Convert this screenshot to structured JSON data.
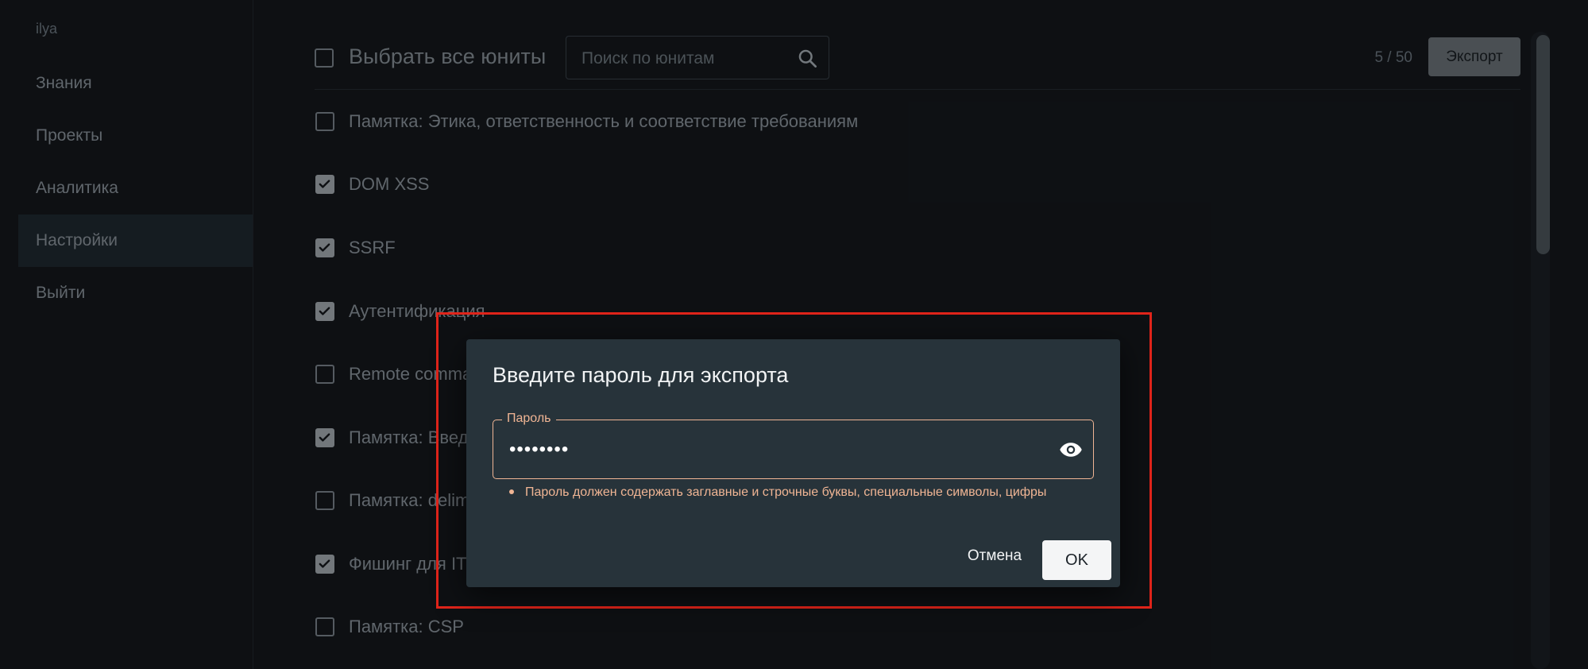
{
  "sidebar": {
    "username": "ilya",
    "items": [
      {
        "label": "Знания"
      },
      {
        "label": "Проекты"
      },
      {
        "label": "Аналитика"
      },
      {
        "label": "Настройки"
      },
      {
        "label": "Выйти"
      }
    ]
  },
  "toolbar": {
    "select_all_label": "Выбрать все юниты",
    "search_placeholder": "Поиск по юнитам",
    "counter": "5 / 50",
    "export_label": "Экспорт"
  },
  "units": [
    {
      "label": "Памятка: Этика, ответственность и соответствие требованиям",
      "checked": false
    },
    {
      "label": "DOM XSS",
      "checked": true
    },
    {
      "label": "SSRF",
      "checked": true
    },
    {
      "label": "Аутентификация",
      "checked": true
    },
    {
      "label": "Remote comma",
      "checked": false
    },
    {
      "label": "Памятка: Введ",
      "checked": true
    },
    {
      "label": "Памятка: delim",
      "checked": false
    },
    {
      "label": "Фишинг для IT",
      "checked": true
    },
    {
      "label": "Памятка: CSP",
      "checked": false
    }
  ],
  "dialog": {
    "title": "Введите пароль для экспорта",
    "password_label": "Пароль",
    "password_value": "••••••••",
    "error": "Пароль должен содержать заглавные и строчные буквы, специальные символы, цифры",
    "cancel_label": "Отмена",
    "ok_label": "OK"
  }
}
